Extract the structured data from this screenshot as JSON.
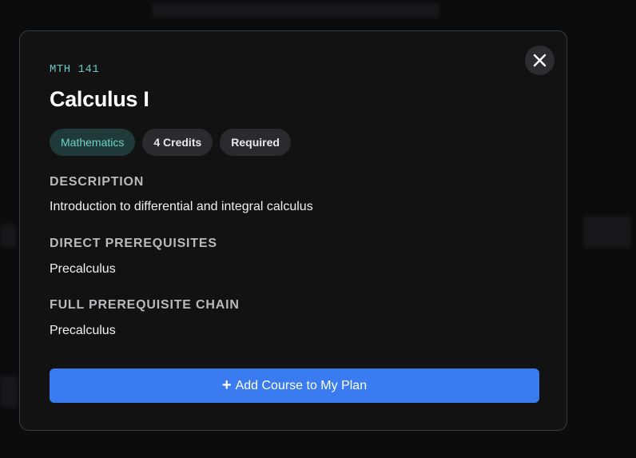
{
  "modal": {
    "course_code": "MTH 141",
    "course_title": "Calculus I",
    "close_icon": "close-icon",
    "tags": [
      {
        "label": "Mathematics"
      },
      {
        "label": "4 Credits"
      },
      {
        "label": "Required"
      }
    ],
    "description": {
      "label": "DESCRIPTION",
      "text": "Introduction to differential and integral calculus"
    },
    "direct_prerequisites": {
      "label": "DIRECT PREREQUISITES",
      "text": "Precalculus"
    },
    "full_prerequisite_chain": {
      "label": "FULL PREREQUISITE CHAIN",
      "text": "Precalculus"
    },
    "add_button": {
      "icon": "plus-icon",
      "label": "Add Course to My Plan"
    }
  },
  "colors": {
    "accent_blue": "#3a7bf0",
    "course_code_teal": "#67c7c2",
    "subject_tag_bg": "#1f3a38",
    "subject_tag_text": "#6fd0c7",
    "modal_bg": "#121212"
  }
}
